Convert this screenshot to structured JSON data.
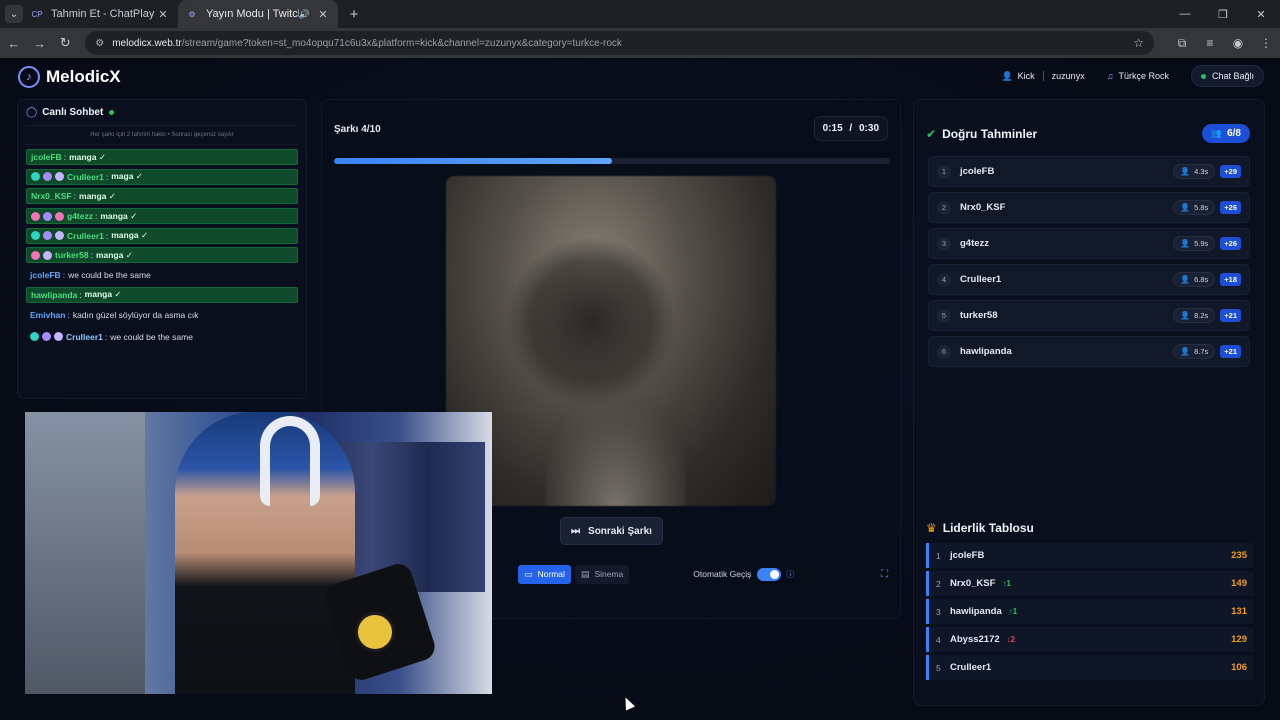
{
  "browser": {
    "tabs": [
      {
        "favicon": "CP",
        "title": "Tahmin Et - ChatPlay",
        "active": false
      },
      {
        "favicon": "⚙",
        "title": "Yayın Modu | Twitch ve Kick",
        "active": true
      }
    ],
    "url_host": "melodicx.web.tr",
    "url_path": "/stream/game?token=st_mo4opqu71c6u3x&platform=kick&channel=zuzunyx&category=turkce-rock"
  },
  "header": {
    "brand": "MelodicX",
    "platform": "Kick",
    "channel": "zuzunyx",
    "category": "Türkçe Rock",
    "status": "Chat Bağlı"
  },
  "chat": {
    "title": "Canlı Sohbet",
    "note": "Her şarkı için 2 tahmin hakkı • Sonrası geçersiz sayılır",
    "messages": [
      {
        "user": "jcoleFB",
        "text": "manga ✓",
        "correct": true,
        "badges": []
      },
      {
        "user": "Crulleer1",
        "text": "maga ✓",
        "correct": true,
        "badges": [
          "b1",
          "b2",
          "b3"
        ]
      },
      {
        "user": "Nrx0_KSF",
        "text": "manga ✓",
        "correct": true,
        "badges": []
      },
      {
        "user": "g4tezz",
        "text": "manga ✓",
        "correct": true,
        "badges": [
          "b4",
          "b2",
          "b4"
        ]
      },
      {
        "user": "Crulleer1",
        "text": "manga ✓",
        "correct": true,
        "badges": [
          "b1",
          "b2",
          "b3"
        ]
      },
      {
        "user": "turker58",
        "text": "manga ✓",
        "correct": true,
        "badges": [
          "b4",
          "b3"
        ]
      },
      {
        "user": "jcoleFB",
        "text": "we could be the same",
        "correct": false,
        "badges": [],
        "color": "u-blue"
      },
      {
        "user": "hawlipanda",
        "text": "manga ✓",
        "correct": true,
        "badges": []
      },
      {
        "user": "Emivhan",
        "text": "kadın güzel söylüyor da asma cık",
        "correct": false,
        "badges": [],
        "color": "u-emi"
      },
      {
        "user": "Crulleer1",
        "text": "we could be the same",
        "correct": false,
        "badges": [
          "b1",
          "b2",
          "b3"
        ],
        "color": "u-cru"
      }
    ]
  },
  "player": {
    "song_label": "Şarkı 4/10",
    "elapsed": "0:15",
    "separator": "/",
    "duration": "0:30",
    "progress": 0.5,
    "next_label": "Sonraki Şarkı",
    "mode_normal": "Normal",
    "mode_cinema": "Sinema",
    "auto_label": "Otomatik Geçiş",
    "auto_on": true
  },
  "correct_guesses": {
    "title": "Doğru Tahminler",
    "count": "6/8",
    "rows": [
      {
        "rank": "1",
        "name": "jcoleFB",
        "time": "4.3s",
        "points": "+29"
      },
      {
        "rank": "2",
        "name": "Nrx0_KSF",
        "time": "5.8s",
        "points": "+26"
      },
      {
        "rank": "3",
        "name": "g4tezz",
        "time": "5.9s",
        "points": "+26"
      },
      {
        "rank": "4",
        "name": "Crulleer1",
        "time": "6.8s",
        "points": "+18"
      },
      {
        "rank": "5",
        "name": "turker58",
        "time": "8.2s",
        "points": "+21"
      },
      {
        "rank": "6",
        "name": "hawlipanda",
        "time": "8.7s",
        "points": "+21"
      }
    ]
  },
  "leaderboard": {
    "title": "Liderlik Tablosu",
    "rows": [
      {
        "rank": "1",
        "name": "jcoleFB",
        "change": "",
        "dir": "",
        "score": "235"
      },
      {
        "rank": "2",
        "name": "Nrx0_KSF",
        "change": "↑1",
        "dir": "up",
        "score": "149"
      },
      {
        "rank": "3",
        "name": "hawlipanda",
        "change": "↑1",
        "dir": "up",
        "score": "131"
      },
      {
        "rank": "4",
        "name": "Abyss2172",
        "change": "↓2",
        "dir": "down",
        "score": "129"
      },
      {
        "rank": "5",
        "name": "Crulleer1",
        "change": "",
        "dir": "",
        "score": "106"
      }
    ]
  },
  "colors": {
    "accent": "#3b82f6",
    "correct_bg": "#0f4a2a",
    "score": "#f59e0b"
  }
}
